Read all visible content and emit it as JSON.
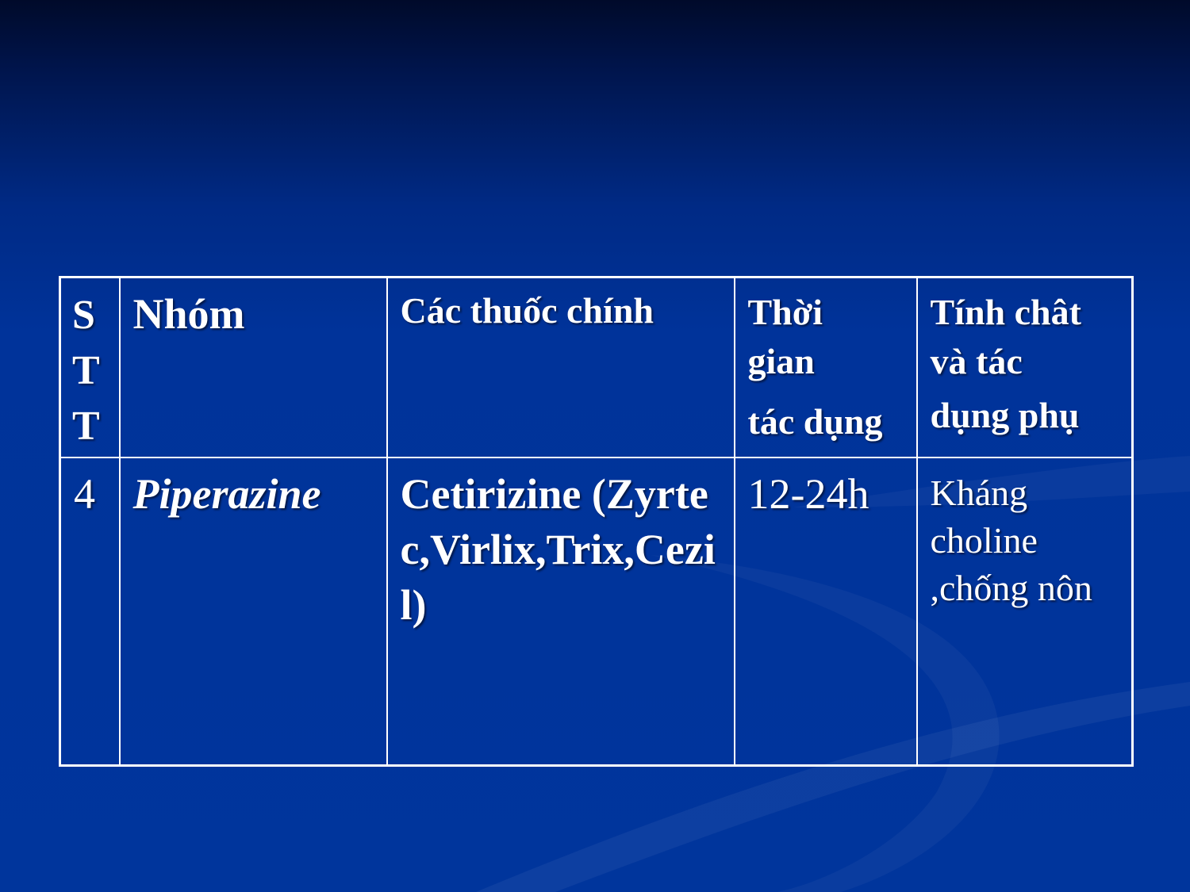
{
  "table": {
    "header": {
      "stt": [
        "S",
        "T",
        "T"
      ],
      "nhom": "Nhóm",
      "cac_thuoc": "Các thuốc chính",
      "thoi_gian": [
        "Thời",
        "gian",
        "tác dụng"
      ],
      "tinh_chat": [
        "Tính chât",
        "và tác",
        "dụng phụ"
      ]
    },
    "rows": [
      {
        "stt": "4",
        "nhom": "Piperazine",
        "cac_thuoc": "Cetirizine (Zyrtec,Virlix,Trix,Cezil)",
        "thoi_gian": "12-24h",
        "tinh_chat": [
          "Kháng",
          "choline",
          ",chống nôn"
        ]
      }
    ]
  },
  "colors": {
    "background": "#00359c",
    "border": "#ffffff",
    "text": "#ffffff"
  }
}
